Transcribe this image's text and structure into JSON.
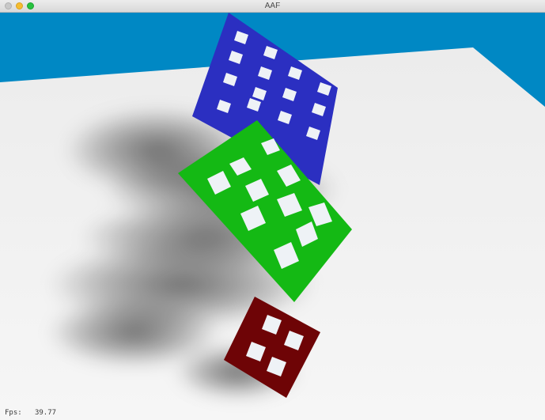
{
  "window": {
    "title": "AAF"
  },
  "scene": {
    "sky_color": "#0088c4",
    "ground_color": "#e6e6e6",
    "panels": [
      {
        "name": "blue-panel",
        "color": "#2b2fc1",
        "grid": "4x4"
      },
      {
        "name": "green-panel",
        "color": "#14b914",
        "grid": "3x3"
      },
      {
        "name": "red-panel",
        "color": "#6e0406",
        "grid": "2x2"
      }
    ]
  },
  "hud": {
    "fps_label": "Fps:",
    "fps_value": "39.77"
  }
}
